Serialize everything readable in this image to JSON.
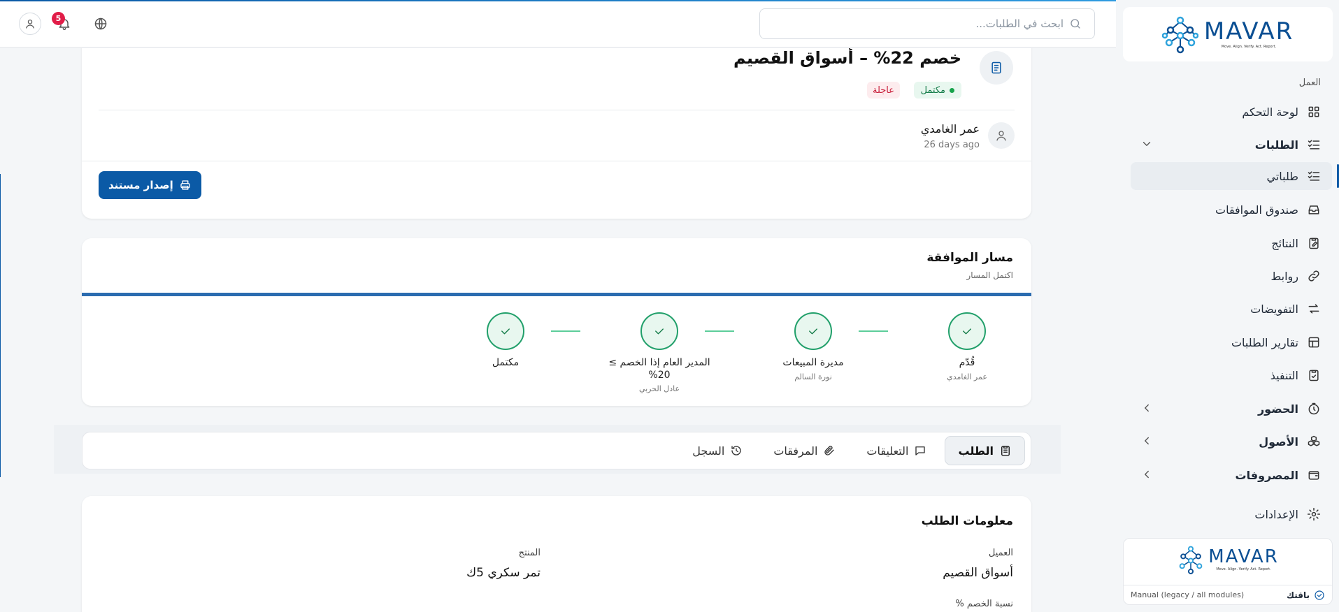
{
  "header": {
    "search_placeholder": "ابحث في الطلبات...",
    "notification_count": "5"
  },
  "sidebar": {
    "section_label": "العمل",
    "items": [
      {
        "label": "لوحة التحكم",
        "icon": "dashboard-icon"
      },
      {
        "label": "الطلبات",
        "icon": "list-check-icon",
        "expanded": true
      },
      {
        "label": "طلباتي",
        "icon": "list-check-icon",
        "active": true
      },
      {
        "label": "صندوق الموافقات",
        "icon": "inbox-icon"
      },
      {
        "label": "النتائج",
        "icon": "clipboard-edit-icon"
      },
      {
        "label": "روابط",
        "icon": "link-icon"
      },
      {
        "label": "التفويضات",
        "icon": "swap-icon"
      },
      {
        "label": "تقارير الطلبات",
        "icon": "table-icon"
      },
      {
        "label": "التنفيذ",
        "icon": "clipboard-check-icon"
      },
      {
        "label": "الحضور",
        "icon": "timer-icon"
      },
      {
        "label": "الأصول",
        "icon": "boxes-icon"
      },
      {
        "label": "المصروفات",
        "icon": "wallet-icon"
      },
      {
        "label": "الإعدادات",
        "icon": "gear-icon"
      }
    ],
    "package": {
      "name": "باقتك",
      "description": "Manual (legacy / all modules)"
    }
  },
  "logo": {
    "text": "MAVAR",
    "tagline": "Move. Align. Verify. Act. Report."
  },
  "request": {
    "title": "خصم 22% – أسواق القصيم",
    "status": "مكتمل",
    "priority": "عاجلة",
    "requester": "عمر الغامدي",
    "time_ago": "26 days ago",
    "issue_button": "إصدار مستند"
  },
  "approval_path": {
    "title": "مسار الموافقة",
    "subtitle": "اكتمل المسار",
    "steps": [
      {
        "label": "قُدّم",
        "person": "عمر الغامدي"
      },
      {
        "label": "مديرة المبيعات",
        "person": "نورة السالم"
      },
      {
        "label": "المدير العام إذا الخصم ≥ 20%",
        "person": "عادل الحربي"
      },
      {
        "label": "مكتمل",
        "person": ""
      }
    ]
  },
  "tabs": [
    {
      "label": "الطلب",
      "icon": "clipboard-list-icon",
      "active": true
    },
    {
      "label": "التعليقات",
      "icon": "comment-icon"
    },
    {
      "label": "المرفقات",
      "icon": "paperclip-icon"
    },
    {
      "label": "السجل",
      "icon": "history-icon"
    }
  ],
  "request_info": {
    "title": "معلومات الطلب",
    "fields": [
      {
        "label": "العميل",
        "value": "أسواق القصيم"
      },
      {
        "label": "المنتج",
        "value": "تمر سكري 5ك"
      },
      {
        "label": "نسبة الخصم %",
        "value": ""
      }
    ]
  }
}
